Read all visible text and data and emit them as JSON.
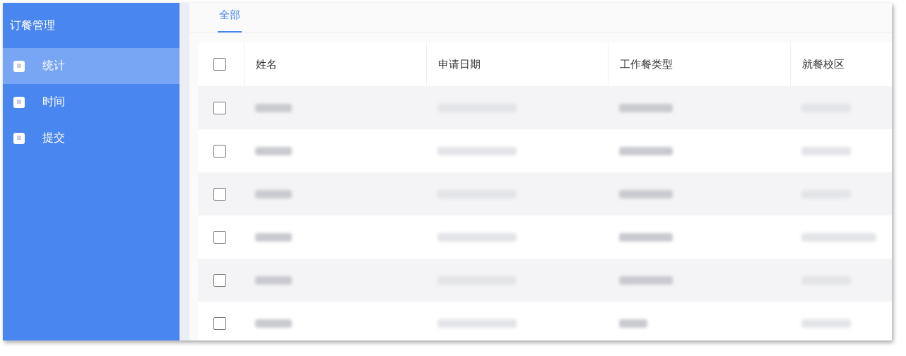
{
  "sidebar": {
    "title": "订餐管理",
    "items": [
      {
        "label": "统计",
        "selected": true
      },
      {
        "label": "时间",
        "selected": false
      },
      {
        "label": "提交",
        "selected": false
      }
    ]
  },
  "tabs": [
    {
      "label": "全部",
      "selected": true
    }
  ],
  "table": {
    "header_checked": false,
    "columns": [
      "姓名",
      "申请日期",
      "工作餐类型",
      "就餐校区"
    ],
    "rows": [
      {
        "checked": false
      },
      {
        "checked": false
      },
      {
        "checked": false
      },
      {
        "checked": false
      },
      {
        "checked": false
      },
      {
        "checked": false
      }
    ]
  }
}
